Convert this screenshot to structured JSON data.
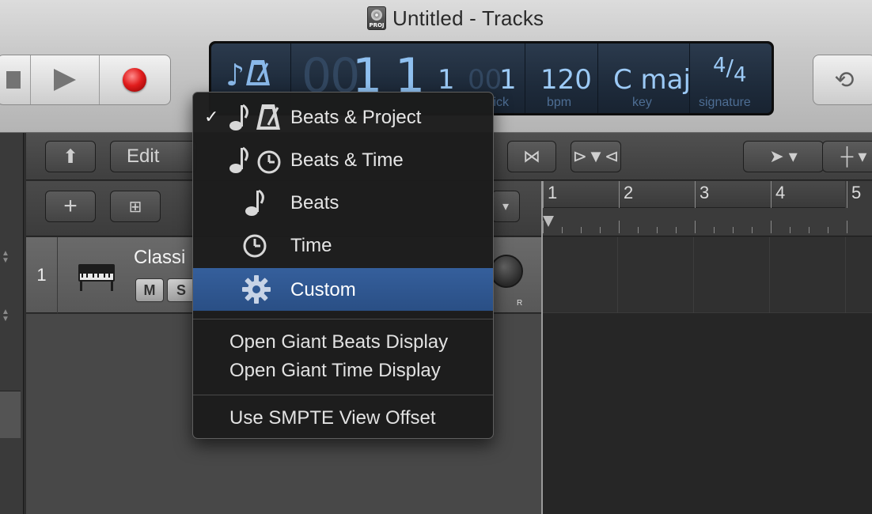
{
  "window": {
    "title": "Untitled - Tracks",
    "doc_icon_label": "PROJ"
  },
  "lcd": {
    "bar_dim": "00",
    "bar": "1",
    "beat": "1",
    "div": "1",
    "tick_dim": "00",
    "tick": "1",
    "tick_label": "tick",
    "tempo": "120",
    "tempo_label": "bpm",
    "key": "C maj",
    "key_label": "key",
    "signature_num": "4",
    "signature_den": "4",
    "signature_label": "signature"
  },
  "tracks_toolbar": {
    "edit_label": "Edit"
  },
  "track": {
    "number": "1",
    "name": "Classi",
    "mute_label": "M",
    "solo_label": "S",
    "knob_label": "R"
  },
  "ruler": {
    "bars": [
      "1",
      "2",
      "3",
      "4",
      "5"
    ]
  },
  "menu": {
    "mode_items": [
      {
        "label": "Beats & Project",
        "checked": true,
        "icons": [
          "note-icon",
          "metronome-icon"
        ]
      },
      {
        "label": "Beats & Time",
        "checked": false,
        "icons": [
          "note-icon",
          "clock-icon"
        ]
      },
      {
        "label": "Beats",
        "checked": false,
        "icons": [
          "note-icon"
        ]
      },
      {
        "label": "Time",
        "checked": false,
        "icons": [
          "clock-icon"
        ]
      },
      {
        "label": "Custom",
        "checked": false,
        "selected": true,
        "icons": [
          "gear-icon"
        ]
      }
    ],
    "giant_beats": "Open Giant Beats Display",
    "giant_time": "Open Giant Time Display",
    "smpte": "Use SMPTE View Offset"
  },
  "colors": {
    "menu_highlight": "#2f5893",
    "lcd_text": "#8fc0f0",
    "record": "#e11d1d"
  }
}
